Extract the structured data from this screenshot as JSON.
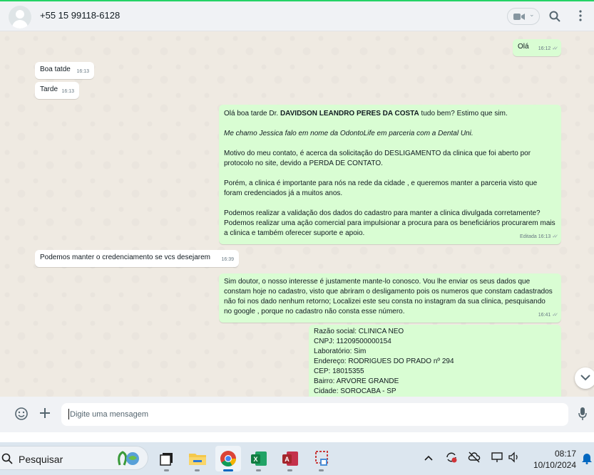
{
  "header": {
    "contact_name": "+55 15 99118-6128"
  },
  "messages": [
    {
      "dir": "out",
      "text": "Olá",
      "time": "16:12",
      "edited": ""
    },
    {
      "dir": "in",
      "text": "Boa tatde",
      "time": "16:13"
    },
    {
      "dir": "in",
      "text": "Tarde",
      "time": "16:13"
    },
    {
      "dir": "out",
      "paragraphs": [
        "Olá boa tarde Dr. DAVIDSON LEANDRO PERES DA COSTA  tudo bem? Estimo que sim.",
        "Me chamo Jessica falo em nome da OdontoLife em parceria com a Dental Uni.",
        "Motivo do meu contato, é acerca da solicitação do DESLIGAMENTO da clinica que foi aberto por protocolo no site, devido a PERDA DE CONTATO.",
        "Porém, a clinica é importante para nós na rede da cidade , e queremos manter a parceria visto que foram credenciados já a muitos anos.",
        "Podemos realizar a validação dos dados do cadastro para manter a clinica divulgada corretamente? Podemos realizar uma ação comercial para impulsionar a procura para os beneficiários procurarem mais a clinica e também oferecer suporte e apoio."
      ],
      "greeting_pre": "Olá boa tarde Dr. ",
      "greeting_name": "DAVIDSON LEANDRO PERES DA COSTA",
      "greeting_post": "  tudo bem? Estimo que sim.",
      "time": "16:13",
      "edited": "Editada"
    },
    {
      "dir": "in",
      "text": "Podemos manter o credenciamento se vcs desejarem",
      "time": "16:39"
    },
    {
      "dir": "out",
      "text": "Sim doutor, o nosso interesse é justamente mante-lo conosco. Vou lhe enviar os seus dados que constam hoje no cadastro, visto que abriram o desligamento pois os numeros que constam cadastrados não foi nos dado nenhum retorno; Localizei este seu consta no instagram da sua clinica, pesquisando no google , porque no cadastro não consta esse número.",
      "time": "16:41"
    },
    {
      "dir": "out",
      "lines": [
        "Razão social: CLINICA NEO",
        "CNPJ: 11209500000154",
        "Laboratório: Sim",
        "Endereço: RODRIGUES DO PRADO nº 294",
        "CEP: 18015355",
        "Bairro: ARVORE GRANDE",
        "Cidade: SOROCABA - SP"
      ]
    }
  ],
  "composer": {
    "placeholder": "Digite uma mensagem"
  },
  "taskbar": {
    "search_label": "Pesquisar",
    "time": "08:17",
    "date": "10/10/2024"
  },
  "colors": {
    "outgoing_bubble": "#d9fdd3",
    "incoming_bubble": "#ffffff",
    "chat_background": "#efeae2",
    "accent": "#25d366"
  },
  "icons": [
    "video-call-icon",
    "search-icon",
    "menu-icon",
    "emoji-icon",
    "attach-plus-icon",
    "microphone-icon",
    "read-ticks-icon",
    "chevron-down-icon"
  ]
}
